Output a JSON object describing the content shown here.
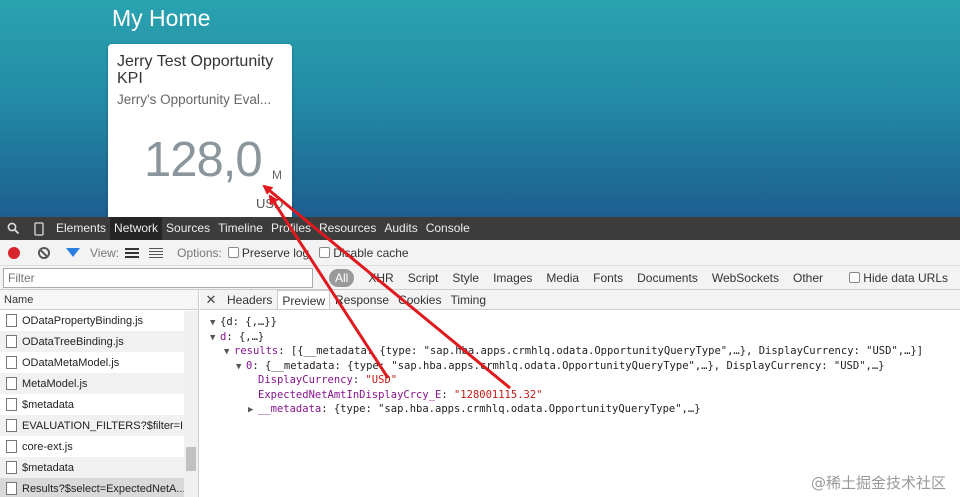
{
  "launchpad": {
    "title": "My Home",
    "tile": {
      "title": "Jerry Test Opportunity KPI",
      "subtitle": "Jerry's Opportunity Eval...",
      "value": "128,0",
      "scale": "M",
      "unit": "USD"
    }
  },
  "devtools": {
    "tabs": [
      "Elements",
      "Network",
      "Sources",
      "Timeline",
      "Profiles",
      "Resources",
      "Audits",
      "Console"
    ],
    "active_tab": "Network",
    "toolbar": {
      "view_label": "View:",
      "options_label": "Options:",
      "preserve_log": "Preserve log",
      "disable_cache": "Disable cache"
    },
    "filter": {
      "placeholder": "Filter",
      "types": [
        "All",
        "XHR",
        "Script",
        "Style",
        "Images",
        "Media",
        "Fonts",
        "Documents",
        "WebSockets",
        "Other"
      ],
      "hide_data_urls": "Hide data URLs"
    },
    "requests": {
      "header": "Name",
      "items": [
        "ODataPropertyBinding.js",
        "ODataTreeBinding.js",
        "ODataMetaModel.js",
        "MetaModel.js",
        "$metadata",
        "EVALUATION_FILTERS?$filter=I...",
        "core-ext.js",
        "$metadata",
        "Results?$select=ExpectedNetA..."
      ]
    },
    "detail": {
      "close": "✕",
      "tabs": [
        "Headers",
        "Preview",
        "Response",
        "Cookies",
        "Timing"
      ],
      "active_tab": "Preview",
      "preview": {
        "l1": "{d: {,…}}",
        "l2_key": "d",
        "l2_val": ": {,…}",
        "l3_key": "results",
        "l3_val": ": [{__metadata: {type: \"sap.hba.apps.crmhlq.odata.OpportunityQueryType\",…}, DisplayCurrency: \"USD\",…}]",
        "l4_key": "0",
        "l4_val": ": {__metadata: {type: \"sap.hba.apps.crmhlq.odata.OpportunityQueryType\",…}, DisplayCurrency: \"USD\",…}",
        "l5_key": "DisplayCurrency",
        "l5_val": "\"USD\"",
        "l6_key": "ExpectedNetAmtInDisplayCrcy_E",
        "l6_val": "\"128001115.32\"",
        "l7_key": "__metadata",
        "l7_val": ": {type: \"sap.hba.apps.crmhlq.odata.OpportunityQueryType\",…}"
      }
    }
  },
  "watermark": "@稀土掘金技术社区",
  "colors": {
    "arrow": "#e0191e",
    "key": "#881391",
    "string": "#c41a16"
  }
}
